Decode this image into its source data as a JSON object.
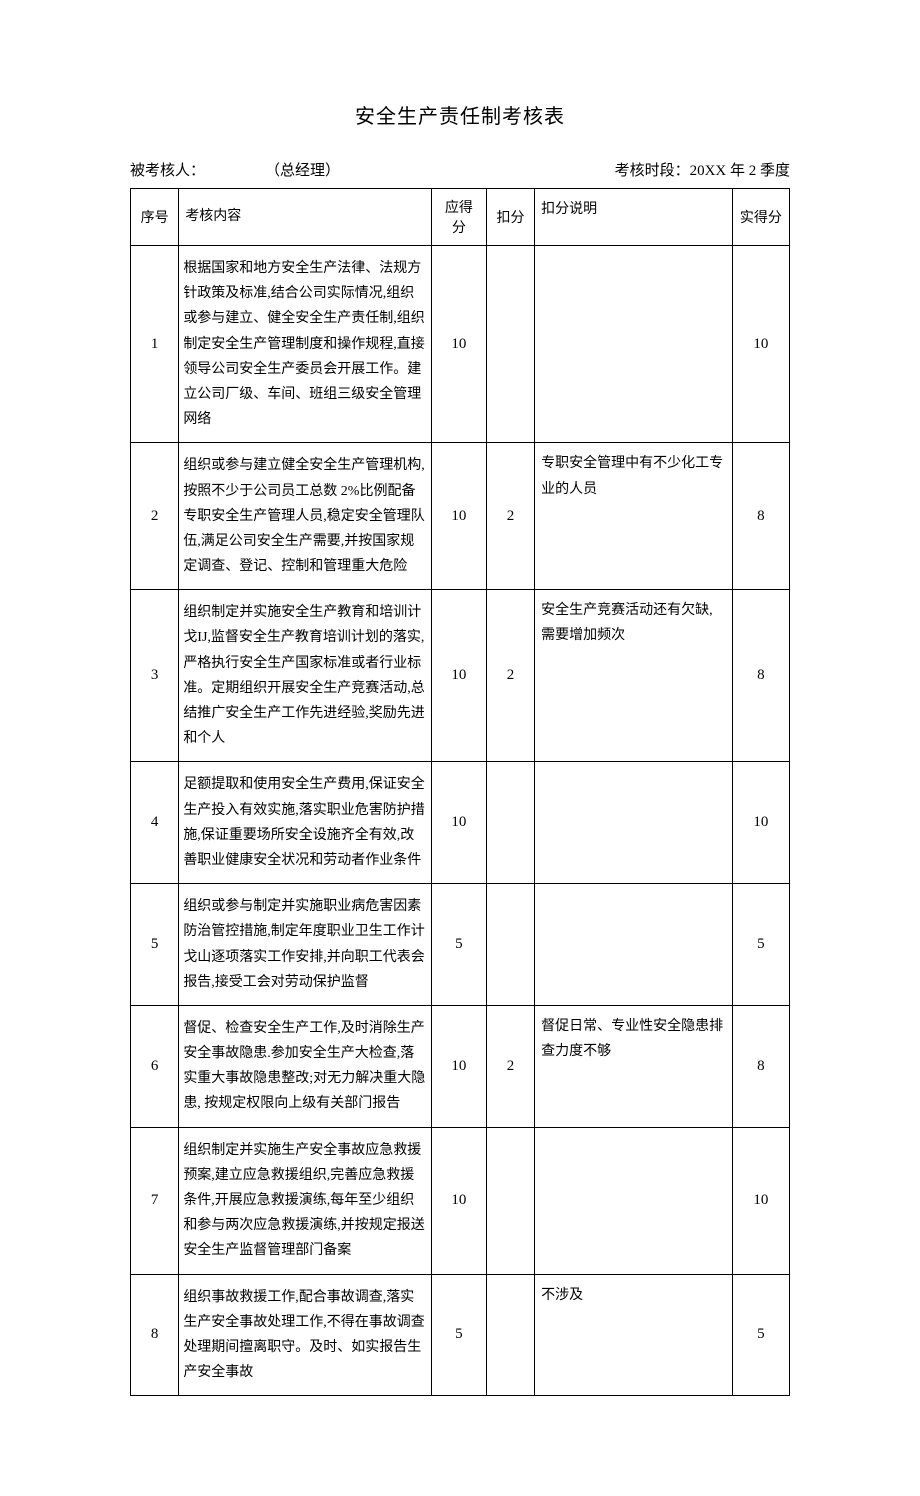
{
  "title": "安全生产责任制考核表",
  "header": {
    "assessee_label": "被考核人：",
    "role": "（总经理）",
    "period_label": "考核时段：",
    "period_value": "20XX 年 2 季度"
  },
  "columns": {
    "seq": "序号",
    "content": "考核内容",
    "score": "应得分",
    "deduct": "扣分",
    "explain": "扣分说明",
    "actual": "实得分"
  },
  "rows": [
    {
      "seq": "1",
      "content": "根据国家和地方安全生产法律、法规方针政策及标准,结合公司实际情况,组织或参与建立、健全安全生产责任制,组织制定安全生产管理制度和操作规程,直接领导公司安全生产委员会开展工作。建立公司厂级、车间、班组三级安全管理网络",
      "score": "10",
      "deduct": "",
      "explain": "",
      "actual": "10"
    },
    {
      "seq": "2",
      "content": "组织或参与建立健全安全生产管理机构,按照不少于公司员工总数 2%比例配备专职安全生产管理人员,稳定安全管理队伍,满足公司安全生产需要,并按国家规定调查、登记、控制和管理重大危险",
      "score": "10",
      "deduct": "2",
      "explain": "专职安全管理中有不少化工专业的人员",
      "actual": "8"
    },
    {
      "seq": "3",
      "content": "组织制定并实施安全生产教育和培训计戈IJ,监督安全生产教育培训计划的落实,严格执行安全生产国家标准或者行业标准。定期组织开展安全生产竞赛活动,总结推广安全生产工作先进经验,奖励先进和个人",
      "score": "10",
      "deduct": "2",
      "explain": "安全生产竞赛活动还有欠缺,需要增加频次",
      "actual": "8"
    },
    {
      "seq": "4",
      "content": "足额提取和使用安全生产费用,保证安全生产投入有效实施,落实职业危害防护措施,保证重要场所安全设施齐全有效,改善职业健康安全状况和劳动者作业条件",
      "score": "10",
      "deduct": "",
      "explain": "",
      "actual": "10"
    },
    {
      "seq": "5",
      "content": "组织或参与制定并实施职业病危害因素防治管控措施,制定年度职业卫生工作计戈山逐项落实工作安排,并向职工代表会报告,接受工会对劳动保护监督",
      "score": "5",
      "deduct": "",
      "explain": "",
      "actual": "5"
    },
    {
      "seq": "6",
      "content": "督促、检查安全生产工作,及时消除生产安全事故隐患.参加安全生产大检查,落实重大事故隐患整改;对无力解决重大隐患, 按规定权限向上级有关部门报告",
      "score": "10",
      "deduct": "2",
      "explain": "督促日常、专业性安全隐患排查力度不够",
      "actual": "8"
    },
    {
      "seq": "7",
      "content": "组织制定并实施生产安全事故应急救援预案,建立应急救援组织,完善应急救援条件,开展应急救援演练,每年至少组织和参与两次应急救援演练,并按规定报送安全生产监督管理部门备案",
      "score": "10",
      "deduct": "",
      "explain": "",
      "actual": "10"
    },
    {
      "seq": "8",
      "content": "组织事故救援工作,配合事故调查,落实生产安全事故处理工作,不得在事故调查处理期间擅离职守。及时、如实报告生产安全事故",
      "score": "5",
      "deduct": "",
      "explain": "不涉及",
      "actual": "5"
    }
  ]
}
